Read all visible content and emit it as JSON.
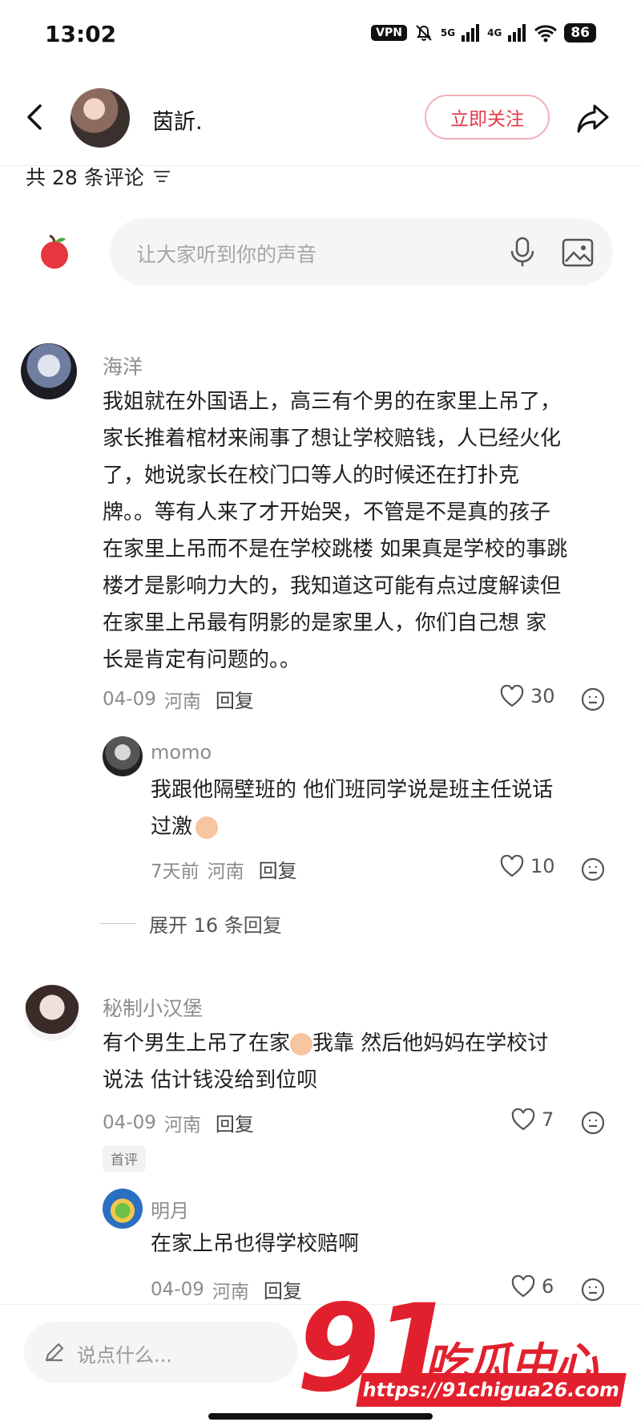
{
  "status": {
    "time": "13:02",
    "vpn": "VPN",
    "sig1": "5G",
    "sig2": "4G",
    "battery": "86"
  },
  "header": {
    "author_name": "茵訢.",
    "follow_label": "立即关注"
  },
  "comments_header": {
    "count_text": "共 28 条评论"
  },
  "input": {
    "placeholder": "让大家听到你的声音"
  },
  "comments": [
    {
      "name": "海洋",
      "text": "我姐就在外国语上，高三有个男的在家里上吊了，\n家长推着棺材来闹事了想让学校赔钱，人已经火化\n了，她说家长在校门口等人的时候还在打扑克\n牌。。等有人来了才开始哭，不管是不是真的孩子\n在家里上吊而不是在学校跳楼 如果真是学校的事跳\n楼才是影响力大的，我知道这可能有点过度解读但\n在家里上吊最有阴影的是家里人，你们自己想 家\n长是肯定有问题的。。",
      "date": "04-09",
      "region": "河南",
      "reply": "回复",
      "likes": "30",
      "sub": {
        "name": "momo",
        "text": "我跟他隔壁班的 他们班同学说是班主任说话\n过激",
        "date": "7天前",
        "region": "河南",
        "reply": "回复",
        "likes": "10"
      },
      "expand": "展开 16 条回复"
    },
    {
      "name": "秘制小汉堡",
      "text_a": "有个男生上吊了在家",
      "text_b": "我靠 然后他妈妈在学校讨",
      "text_c": "说法 估计钱没给到位呗",
      "date": "04-09",
      "region": "河南",
      "reply": "回复",
      "likes": "7",
      "tag": "首评",
      "sub": {
        "name": "明月",
        "text": "在家上吊也得学校赔啊",
        "date": "04-09",
        "region": "河南",
        "reply": "回复",
        "likes": "6"
      }
    }
  ],
  "bottom": {
    "placeholder": "说点什么..."
  },
  "watermark": {
    "big": "91",
    "text": "吃瓜中心",
    "url": "https://91chigua26.com"
  },
  "colors": {
    "accent": "#e23a4a",
    "watermark": "#e2202d"
  }
}
